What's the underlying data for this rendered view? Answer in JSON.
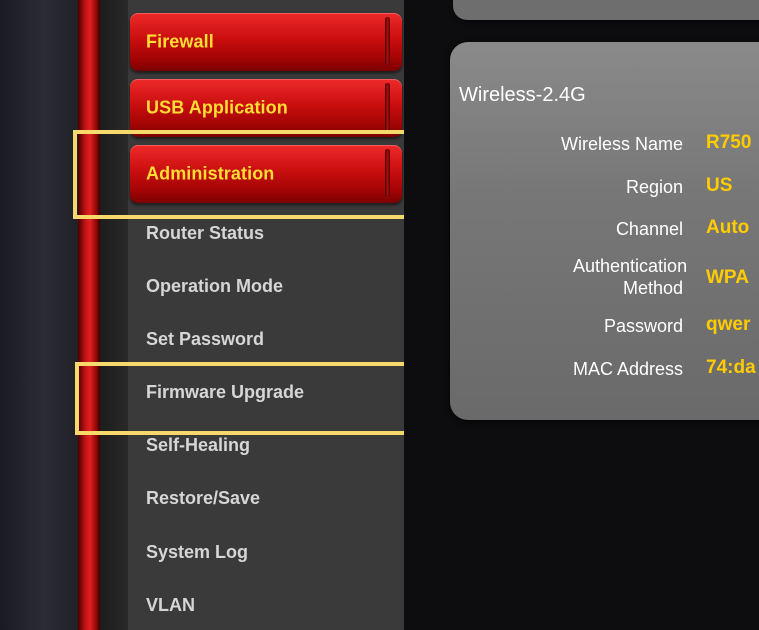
{
  "menu": {
    "red_buttons": [
      {
        "label": "Firewall"
      },
      {
        "label": "USB Application"
      },
      {
        "label": "Administration"
      }
    ],
    "sub_items": [
      {
        "label": "Router Status"
      },
      {
        "label": "Operation Mode"
      },
      {
        "label": "Set Password"
      },
      {
        "label": "Firmware Upgrade"
      },
      {
        "label": "Self-Healing"
      },
      {
        "label": "Restore/Save"
      },
      {
        "label": "System Log"
      },
      {
        "label": "VLAN"
      }
    ]
  },
  "wireless_panel": {
    "title": "Wireless-2.4G",
    "rows": [
      {
        "label": "Wireless Name",
        "value": "R750"
      },
      {
        "label": "Region",
        "value": "US"
      },
      {
        "label": "Channel",
        "value": "Auto"
      },
      {
        "label": "Authentication Method",
        "value": "WPA"
      },
      {
        "label": "Password",
        "value": "qwer"
      },
      {
        "label": "MAC Address",
        "value": "74:da"
      }
    ]
  },
  "colors": {
    "accent_red": "#c90e0e",
    "menu_label_yellow": "#ffde33",
    "value_yellow": "#ffcc00",
    "highlight_box": "#f5d96a"
  }
}
